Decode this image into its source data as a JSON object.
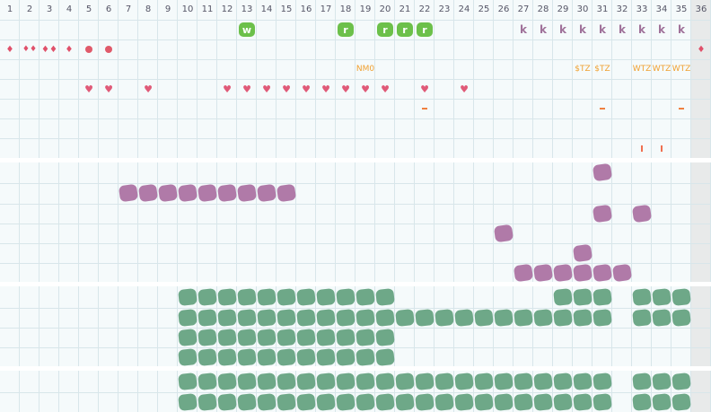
{
  "columns": [
    "1",
    "2",
    "3",
    "4",
    "5",
    "6",
    "7",
    "8",
    "9",
    "10",
    "11",
    "12",
    "13",
    "14",
    "15",
    "16",
    "17",
    "18",
    "19",
    "20",
    "21",
    "22",
    "23",
    "24",
    "25",
    "26",
    "27",
    "28",
    "29",
    "30",
    "31",
    "32",
    "33",
    "34",
    "35",
    "36"
  ],
  "colors": {
    "green_badge": "#6cc04a",
    "k_text": "#a0729a",
    "drop": "#e0506a",
    "heart": "#e05a78",
    "orange_text": "#f0a030",
    "purple_blob": "#b07aa8",
    "green_blob": "#6ea888"
  },
  "row_badges": {
    "13": "w",
    "18": "r",
    "20": "r",
    "21": "r",
    "22": "r"
  },
  "row_k": {
    "letter": "k",
    "cols": [
      27,
      28,
      29,
      30,
      31,
      32,
      33,
      34,
      35
    ]
  },
  "row_drops": {
    "1": "single",
    "2": "double",
    "3": "pair",
    "4": "single",
    "5": "dot",
    "6": "dot",
    "36": "single"
  },
  "row_orange_labels": {
    "19": "NM0",
    "30": "$TZ",
    "31": "$TZ",
    "33": "WTZ",
    "34": "WTZ",
    "35": "WTZ"
  },
  "row_hearts": [
    5,
    6,
    8,
    12,
    13,
    14,
    15,
    16,
    17,
    18,
    19,
    20,
    22,
    24
  ],
  "row_dashes": [
    22,
    31,
    35
  ],
  "row_ticks": [
    33,
    34
  ],
  "purple_rows": [
    [
      31
    ],
    [
      7,
      8,
      9,
      10,
      11,
      12,
      13,
      14,
      15
    ],
    [
      31,
      33
    ],
    [
      26
    ],
    [
      30
    ],
    [
      27,
      28,
      29,
      30,
      31,
      32
    ]
  ],
  "green_block1": [
    [
      10,
      11,
      12,
      13,
      14,
      15,
      16,
      17,
      18,
      19,
      20,
      29,
      30,
      31,
      33,
      34,
      35
    ],
    [
      10,
      11,
      12,
      13,
      14,
      15,
      16,
      17,
      18,
      19,
      20,
      21,
      22,
      23,
      24,
      25,
      26,
      27,
      28,
      29,
      30,
      31,
      33,
      34,
      35
    ],
    [
      10,
      11,
      12,
      13,
      14,
      15,
      16,
      17,
      18,
      19,
      20
    ],
    [
      10,
      11,
      12,
      13,
      14,
      15,
      16,
      17,
      18,
      19,
      20
    ]
  ],
  "green_block2": [
    [
      10,
      11,
      12,
      13,
      14,
      15,
      16,
      17,
      18,
      19,
      20,
      21,
      22,
      23,
      24,
      25,
      26,
      27,
      28,
      29,
      30,
      31,
      33,
      34,
      35
    ],
    [
      10,
      11,
      12,
      13,
      14,
      15,
      16,
      17,
      18,
      19,
      20,
      21,
      22,
      23,
      24,
      25,
      26,
      27,
      28,
      29,
      30,
      31,
      33,
      34,
      35
    ]
  ]
}
